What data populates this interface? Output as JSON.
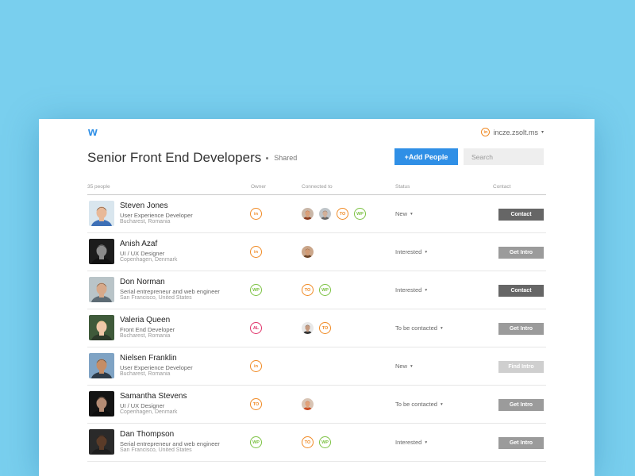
{
  "header": {
    "logo": "w",
    "user_badge": "in",
    "username": "incze.zsolt.ms",
    "caret": "▾"
  },
  "page": {
    "title": "Senior Front End Developers",
    "shared_label": "Shared",
    "add_button": "+Add People",
    "search_placeholder": "Search"
  },
  "table": {
    "columns": {
      "people": "35 people",
      "owner": "Owner",
      "connected": "Connected to",
      "status": "Status",
      "contact": "Contact"
    },
    "rows": [
      {
        "name": "Steven Jones",
        "role": "User Experience Developer",
        "location": "Bucharest, Romania",
        "owner": "in",
        "connected": [
          "face",
          "face",
          "TO",
          "WP"
        ],
        "status": "New",
        "action": "Contact",
        "action_type": "contact",
        "avatar": {
          "bg": "#d9e6ee",
          "skin": "#e8b998",
          "hair": "#5a3a22",
          "shirt": "#3d6fb6"
        }
      },
      {
        "name": "Anish Azaf",
        "role": "UI / UX Designer",
        "location": "Copenhagen,  Denmark",
        "owner": "in",
        "connected": [
          "face"
        ],
        "status": "Interested",
        "action": "Get Intro",
        "action_type": "intro",
        "avatar": {
          "bg": "#1c1c1c",
          "skin": "#8a8a8a",
          "hair": "#2a2a2a",
          "shirt": "#111111"
        }
      },
      {
        "name": "Don Norman",
        "role": "Serial entrepreneur and web engineer",
        "location": "San Francisco,  United States",
        "owner": "WP",
        "connected": [
          "TO",
          "WP"
        ],
        "status": "Interested",
        "action": "Contact",
        "action_type": "contact",
        "avatar": {
          "bg": "#b9c4c8",
          "skin": "#d7a98a",
          "hair": "#6b4a33",
          "shirt": "#5d6b74"
        }
      },
      {
        "name": "Valeria Queen",
        "role": "Front End Developer",
        "location": "Bucharest, Romania",
        "owner": "AL",
        "connected": [
          "face",
          "TO"
        ],
        "status": "To be contacted",
        "action": "Get Intro",
        "action_type": "intro",
        "avatar": {
          "bg": "#3f5a3a",
          "skin": "#f0c8a8",
          "hair": "#e7c77a",
          "shirt": "#2c3a2a"
        }
      },
      {
        "name": "Nielsen Franklin",
        "role": "User Experience Developer",
        "location": "Bucharest, Romania",
        "owner": "in",
        "connected": [],
        "status": "New",
        "action": "Find Intro",
        "action_type": "find",
        "avatar": {
          "bg": "#7fa3c4",
          "skin": "#c58d66",
          "hair": "#4a3a2a",
          "shirt": "#2d3b49"
        }
      },
      {
        "name": "Samantha Stevens",
        "role": "UI / UX Designer",
        "location": "Copenhagen,  Denmark",
        "owner": "TO",
        "connected": [
          "face"
        ],
        "status": "To be contacted",
        "action": "Get Intro",
        "action_type": "intro",
        "avatar": {
          "bg": "#141414",
          "skin": "#b58c74",
          "hair": "#2b1f18",
          "shirt": "#0d0d0d"
        }
      },
      {
        "name": "Dan Thompson",
        "role": "Serial entrepreneur and web engineer",
        "location": "San Francisco,  United States",
        "owner": "WP",
        "connected": [
          "TO",
          "WP"
        ],
        "status": "Interested",
        "action": "Get Intro",
        "action_type": "intro",
        "avatar": {
          "bg": "#2a2a2a",
          "skin": "#5a3b28",
          "hair": "#1a1a1a",
          "shirt": "#1e1e1e"
        }
      }
    ]
  },
  "colors": {
    "background": "#79cfee",
    "primary": "#2f8fe6",
    "badge_in": "#f08a24",
    "badge_to": "#f08a24",
    "badge_wp": "#7cc243",
    "badge_al": "#e0336a"
  }
}
